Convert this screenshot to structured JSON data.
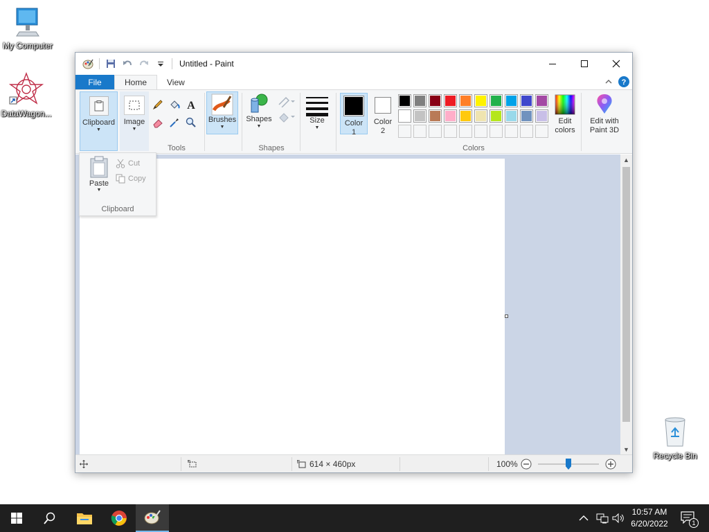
{
  "desktop": {
    "icons": [
      {
        "label": "My Computer"
      },
      {
        "label": "DataWagon..."
      },
      {
        "label": "Recycle Bin"
      }
    ]
  },
  "window": {
    "title": "Untitled - Paint",
    "tabs": {
      "file": "File",
      "home": "Home",
      "view": "View"
    },
    "ribbon": {
      "clipboard_label": "Clipboard",
      "image_label": "Image",
      "tools_title": "Tools",
      "brushes_label": "Brushes",
      "shapes_label": "Shapes",
      "shapes_title": "Shapes",
      "size_label": "Size",
      "color1_label": "Color 1",
      "color1_line1": "Color",
      "color1_line2": "1",
      "color2_line1": "Color",
      "color2_line2": "2",
      "colors_title": "Colors",
      "edit_colors_line1": "Edit",
      "edit_colors_line2": "colors",
      "paint3d_line1": "Edit with",
      "paint3d_line2": "Paint 3D"
    },
    "clipboard_dropdown": {
      "paste_label": "Paste",
      "cut_label": "Cut",
      "copy_label": "Copy",
      "title": "Clipboard"
    },
    "palette": {
      "row1": [
        "#000000",
        "#7f7f7f",
        "#880015",
        "#ed1c24",
        "#ff7f27",
        "#fff200",
        "#22b14c",
        "#00a2e8",
        "#3f48cc",
        "#a349a4"
      ],
      "row2": [
        "#ffffff",
        "#c3c3c3",
        "#b97a57",
        "#ffaec9",
        "#ffc90e",
        "#efe4b0",
        "#b5e61d",
        "#99d9ea",
        "#7092be",
        "#c8bfe7"
      ],
      "row3": [
        "#ffffff",
        "#ffffff",
        "#ffffff",
        "#ffffff",
        "#ffffff",
        "#ffffff",
        "#ffffff",
        "#ffffff",
        "#ffffff",
        "#ffffff"
      ],
      "color1": "#000000",
      "color2": "#ffffff"
    },
    "status": {
      "image_size": "614 × 460px",
      "zoom": "100%"
    }
  },
  "taskbar": {
    "time": "10:57 AM",
    "date": "6/20/2022",
    "notification_count": "1"
  }
}
